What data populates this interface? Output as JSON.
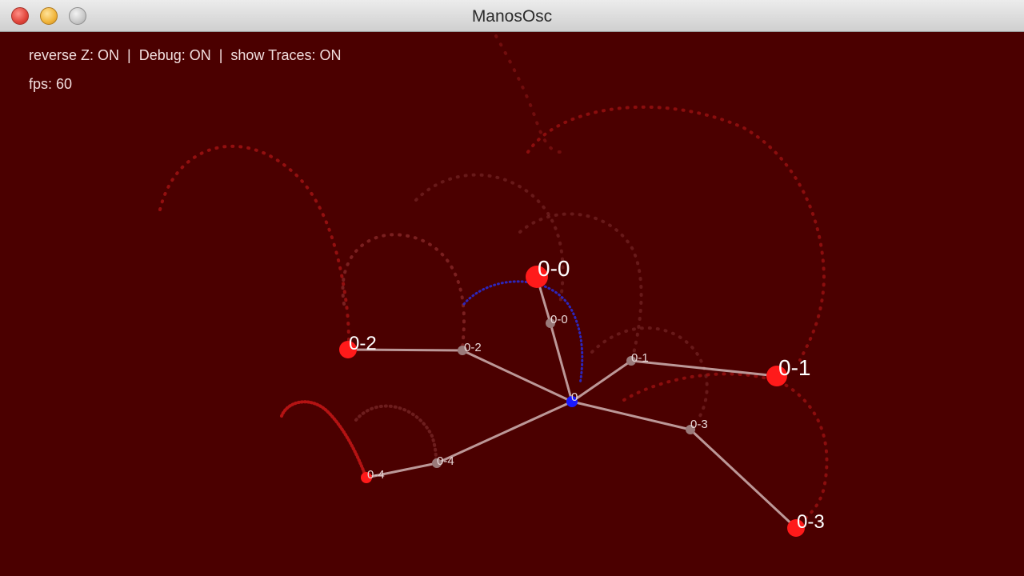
{
  "window": {
    "title": "ManosOsc"
  },
  "hud": {
    "status_line": "reverse Z: ON  |  Debug: ON  |  show Traces: ON",
    "fps_line": "fps: 60"
  },
  "scene": {
    "center_label": "0",
    "tips": [
      {
        "label": "0-0"
      },
      {
        "label": "0-1"
      },
      {
        "label": "0-2"
      },
      {
        "label": "0-3"
      },
      {
        "label": "0-4"
      }
    ],
    "joints": [
      {
        "label": "0-0"
      },
      {
        "label": "0-1"
      },
      {
        "label": "0-2"
      },
      {
        "label": "0-3"
      },
      {
        "label": "0-4"
      }
    ]
  },
  "colors": {
    "background": "#4b0000",
    "tip": "#ff1a1a",
    "joint": "#9a7a7a",
    "center": "#1a1aff",
    "bone": "#c9a9a9",
    "trace": "#b01010"
  }
}
